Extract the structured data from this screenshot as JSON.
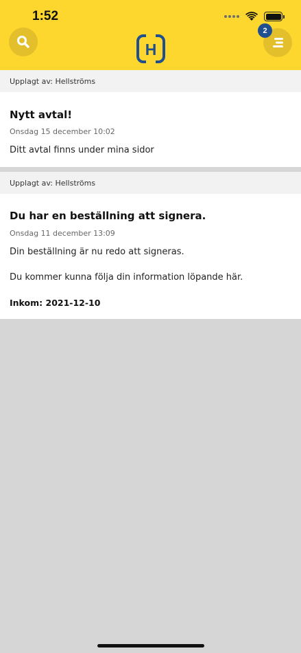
{
  "status_bar": {
    "time": "1:52"
  },
  "header": {
    "notification_count": "2",
    "logo_letter": "H",
    "brand_color": "#fdd72e",
    "accent_color": "#1f4f8f"
  },
  "messages": [
    {
      "posted_by": "Upplagt av: Hellströms",
      "title": "Nytt avtal!",
      "date": "Onsdag 15 december 10:02",
      "body": "Ditt avtal finns under mina sidor"
    },
    {
      "posted_by": "Upplagt av: Hellströms",
      "title": "Du har en beställning att signera.",
      "date": "Onsdag 11 december 13:09",
      "body_1": "Din beställning är nu redo att signeras.",
      "body_2": "Du kommer kunna följa din information löpande här.",
      "received": "Inkom: 2021-12-10"
    }
  ]
}
